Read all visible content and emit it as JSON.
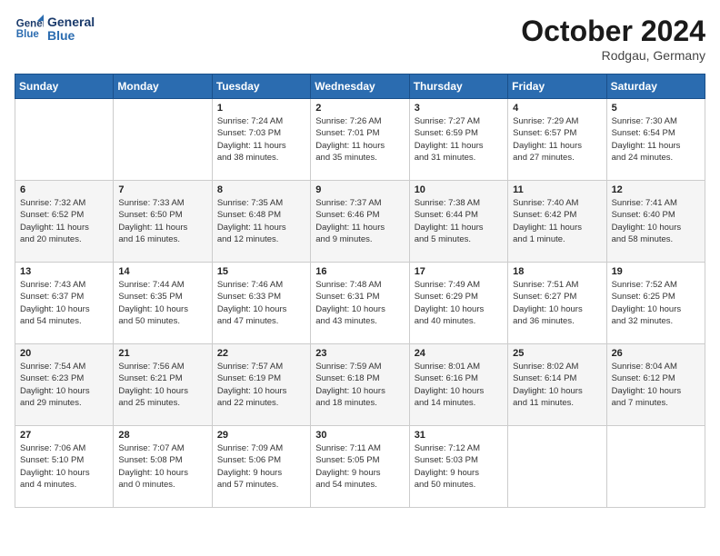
{
  "header": {
    "logo_line1": "General",
    "logo_line2": "Blue",
    "month": "October 2024",
    "location": "Rodgau, Germany"
  },
  "days_of_week": [
    "Sunday",
    "Monday",
    "Tuesday",
    "Wednesday",
    "Thursday",
    "Friday",
    "Saturday"
  ],
  "weeks": [
    [
      {
        "day": "",
        "info": ""
      },
      {
        "day": "",
        "info": ""
      },
      {
        "day": "1",
        "info": "Sunrise: 7:24 AM\nSunset: 7:03 PM\nDaylight: 11 hours\nand 38 minutes."
      },
      {
        "day": "2",
        "info": "Sunrise: 7:26 AM\nSunset: 7:01 PM\nDaylight: 11 hours\nand 35 minutes."
      },
      {
        "day": "3",
        "info": "Sunrise: 7:27 AM\nSunset: 6:59 PM\nDaylight: 11 hours\nand 31 minutes."
      },
      {
        "day": "4",
        "info": "Sunrise: 7:29 AM\nSunset: 6:57 PM\nDaylight: 11 hours\nand 27 minutes."
      },
      {
        "day": "5",
        "info": "Sunrise: 7:30 AM\nSunset: 6:54 PM\nDaylight: 11 hours\nand 24 minutes."
      }
    ],
    [
      {
        "day": "6",
        "info": "Sunrise: 7:32 AM\nSunset: 6:52 PM\nDaylight: 11 hours\nand 20 minutes."
      },
      {
        "day": "7",
        "info": "Sunrise: 7:33 AM\nSunset: 6:50 PM\nDaylight: 11 hours\nand 16 minutes."
      },
      {
        "day": "8",
        "info": "Sunrise: 7:35 AM\nSunset: 6:48 PM\nDaylight: 11 hours\nand 12 minutes."
      },
      {
        "day": "9",
        "info": "Sunrise: 7:37 AM\nSunset: 6:46 PM\nDaylight: 11 hours\nand 9 minutes."
      },
      {
        "day": "10",
        "info": "Sunrise: 7:38 AM\nSunset: 6:44 PM\nDaylight: 11 hours\nand 5 minutes."
      },
      {
        "day": "11",
        "info": "Sunrise: 7:40 AM\nSunset: 6:42 PM\nDaylight: 11 hours\nand 1 minute."
      },
      {
        "day": "12",
        "info": "Sunrise: 7:41 AM\nSunset: 6:40 PM\nDaylight: 10 hours\nand 58 minutes."
      }
    ],
    [
      {
        "day": "13",
        "info": "Sunrise: 7:43 AM\nSunset: 6:37 PM\nDaylight: 10 hours\nand 54 minutes."
      },
      {
        "day": "14",
        "info": "Sunrise: 7:44 AM\nSunset: 6:35 PM\nDaylight: 10 hours\nand 50 minutes."
      },
      {
        "day": "15",
        "info": "Sunrise: 7:46 AM\nSunset: 6:33 PM\nDaylight: 10 hours\nand 47 minutes."
      },
      {
        "day": "16",
        "info": "Sunrise: 7:48 AM\nSunset: 6:31 PM\nDaylight: 10 hours\nand 43 minutes."
      },
      {
        "day": "17",
        "info": "Sunrise: 7:49 AM\nSunset: 6:29 PM\nDaylight: 10 hours\nand 40 minutes."
      },
      {
        "day": "18",
        "info": "Sunrise: 7:51 AM\nSunset: 6:27 PM\nDaylight: 10 hours\nand 36 minutes."
      },
      {
        "day": "19",
        "info": "Sunrise: 7:52 AM\nSunset: 6:25 PM\nDaylight: 10 hours\nand 32 minutes."
      }
    ],
    [
      {
        "day": "20",
        "info": "Sunrise: 7:54 AM\nSunset: 6:23 PM\nDaylight: 10 hours\nand 29 minutes."
      },
      {
        "day": "21",
        "info": "Sunrise: 7:56 AM\nSunset: 6:21 PM\nDaylight: 10 hours\nand 25 minutes."
      },
      {
        "day": "22",
        "info": "Sunrise: 7:57 AM\nSunset: 6:19 PM\nDaylight: 10 hours\nand 22 minutes."
      },
      {
        "day": "23",
        "info": "Sunrise: 7:59 AM\nSunset: 6:18 PM\nDaylight: 10 hours\nand 18 minutes."
      },
      {
        "day": "24",
        "info": "Sunrise: 8:01 AM\nSunset: 6:16 PM\nDaylight: 10 hours\nand 14 minutes."
      },
      {
        "day": "25",
        "info": "Sunrise: 8:02 AM\nSunset: 6:14 PM\nDaylight: 10 hours\nand 11 minutes."
      },
      {
        "day": "26",
        "info": "Sunrise: 8:04 AM\nSunset: 6:12 PM\nDaylight: 10 hours\nand 7 minutes."
      }
    ],
    [
      {
        "day": "27",
        "info": "Sunrise: 7:06 AM\nSunset: 5:10 PM\nDaylight: 10 hours\nand 4 minutes."
      },
      {
        "day": "28",
        "info": "Sunrise: 7:07 AM\nSunset: 5:08 PM\nDaylight: 10 hours\nand 0 minutes."
      },
      {
        "day": "29",
        "info": "Sunrise: 7:09 AM\nSunset: 5:06 PM\nDaylight: 9 hours\nand 57 minutes."
      },
      {
        "day": "30",
        "info": "Sunrise: 7:11 AM\nSunset: 5:05 PM\nDaylight: 9 hours\nand 54 minutes."
      },
      {
        "day": "31",
        "info": "Sunrise: 7:12 AM\nSunset: 5:03 PM\nDaylight: 9 hours\nand 50 minutes."
      },
      {
        "day": "",
        "info": ""
      },
      {
        "day": "",
        "info": ""
      }
    ]
  ]
}
